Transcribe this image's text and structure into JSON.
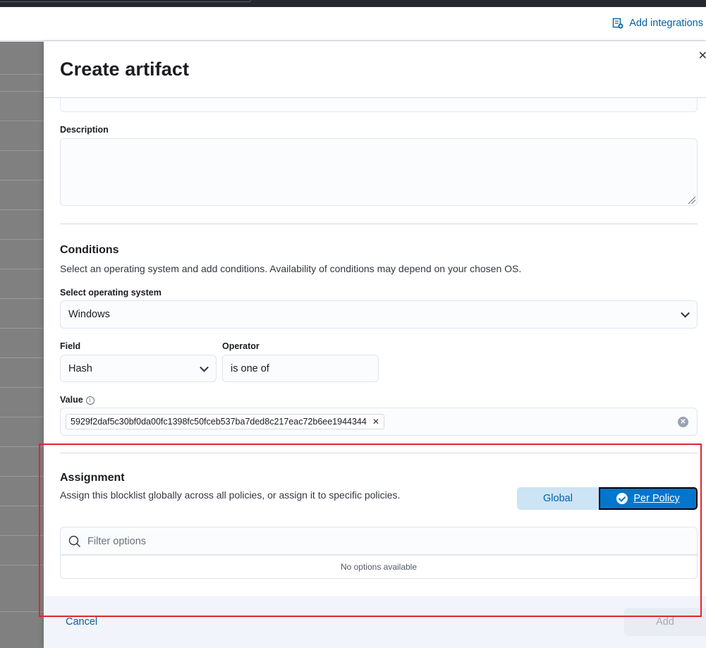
{
  "header": {
    "add_integrations_label": "Add integrations",
    "add_integrations_icon": "integrations-icon"
  },
  "flyout": {
    "title": "Create artifact",
    "close_icon": "close-icon",
    "description": {
      "label": "Description",
      "value": ""
    },
    "conditions": {
      "title": "Conditions",
      "subtitle": "Select an operating system and add conditions. Availability of conditions may depend on your chosen OS.",
      "os_label": "Select operating system",
      "os_value": "Windows",
      "field_label": "Field",
      "field_value": "Hash",
      "operator_label": "Operator",
      "operator_value": "is one of",
      "value_label": "Value",
      "value_chips": [
        "5929f2daf5c30bf0da00fc1398fc50fceb537ba7ded8c217eac72b6ee1944344"
      ]
    },
    "assignment": {
      "title": "Assignment",
      "subtitle": "Assign this blocklist globally across all policies, or assign it to specific policies.",
      "global_label": "Global",
      "per_policy_label": "Per Policy",
      "selected": "Per Policy",
      "filter_placeholder": "Filter options",
      "no_options_text": "No options available"
    },
    "footer": {
      "cancel_label": "Cancel",
      "add_label": "Add"
    }
  },
  "colors": {
    "accent": "#0077cc",
    "link": "#0061a6",
    "highlight": "#e0262f"
  }
}
